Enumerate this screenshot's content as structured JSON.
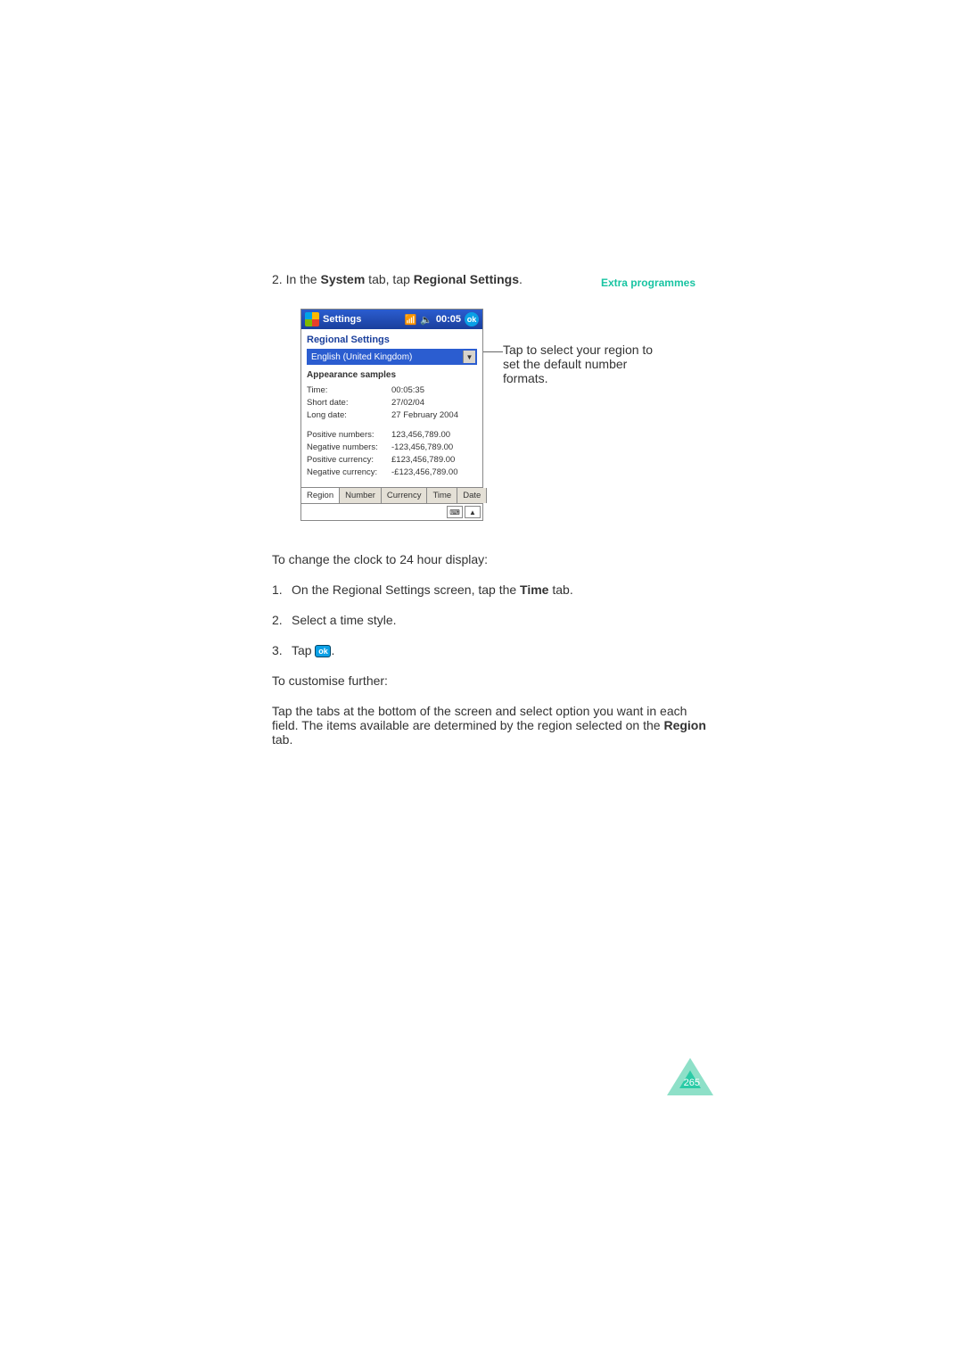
{
  "header": {
    "section": "Extra programmes"
  },
  "step2": {
    "prefix": "2.  In the ",
    "bold1": "System",
    "mid": " tab, tap ",
    "bold2": "Regional Settings",
    "suffix": "."
  },
  "device": {
    "title": "Settings",
    "time_indicator": "00:05",
    "ok": "ok",
    "section_title": "Regional Settings",
    "dropdown_value": "English (United Kingdom)",
    "subheading": "Appearance samples",
    "samples1": [
      {
        "k": "Time:",
        "v": "00:05:35"
      },
      {
        "k": "Short date:",
        "v": "27/02/04"
      },
      {
        "k": "Long date:",
        "v": "27 February 2004"
      }
    ],
    "samples2": [
      {
        "k": "Positive numbers:",
        "v": "123,456,789.00"
      },
      {
        "k": "Negative numbers:",
        "v": "-123,456,789.00"
      },
      {
        "k": "Positive currency:",
        "v": "£123,456,789.00"
      },
      {
        "k": "Negative currency:",
        "v": "-£123,456,789.00"
      }
    ],
    "tabs": [
      "Region",
      "Number",
      "Currency",
      "Time",
      "Date"
    ]
  },
  "callout": "Tap to select your region to set the default number formats.",
  "para_clock": "To change the clock to 24 hour display:",
  "list": [
    {
      "n": "1.",
      "pre": "On the Regional Settings screen, tap the ",
      "bold": "Time",
      "post": " tab."
    },
    {
      "n": "2.",
      "pre": "Select a time style.",
      "bold": "",
      "post": ""
    },
    {
      "n": "3.",
      "pre": "Tap ",
      "icon": "ok",
      "post": "."
    }
  ],
  "para_cust": "To customise further:",
  "para_tabs": {
    "pre": "Tap the tabs at the bottom of the screen and select option you want in each field. The items available are determined by the region selected on the ",
    "bold": "Region",
    "post": " tab."
  },
  "page_number": "265"
}
